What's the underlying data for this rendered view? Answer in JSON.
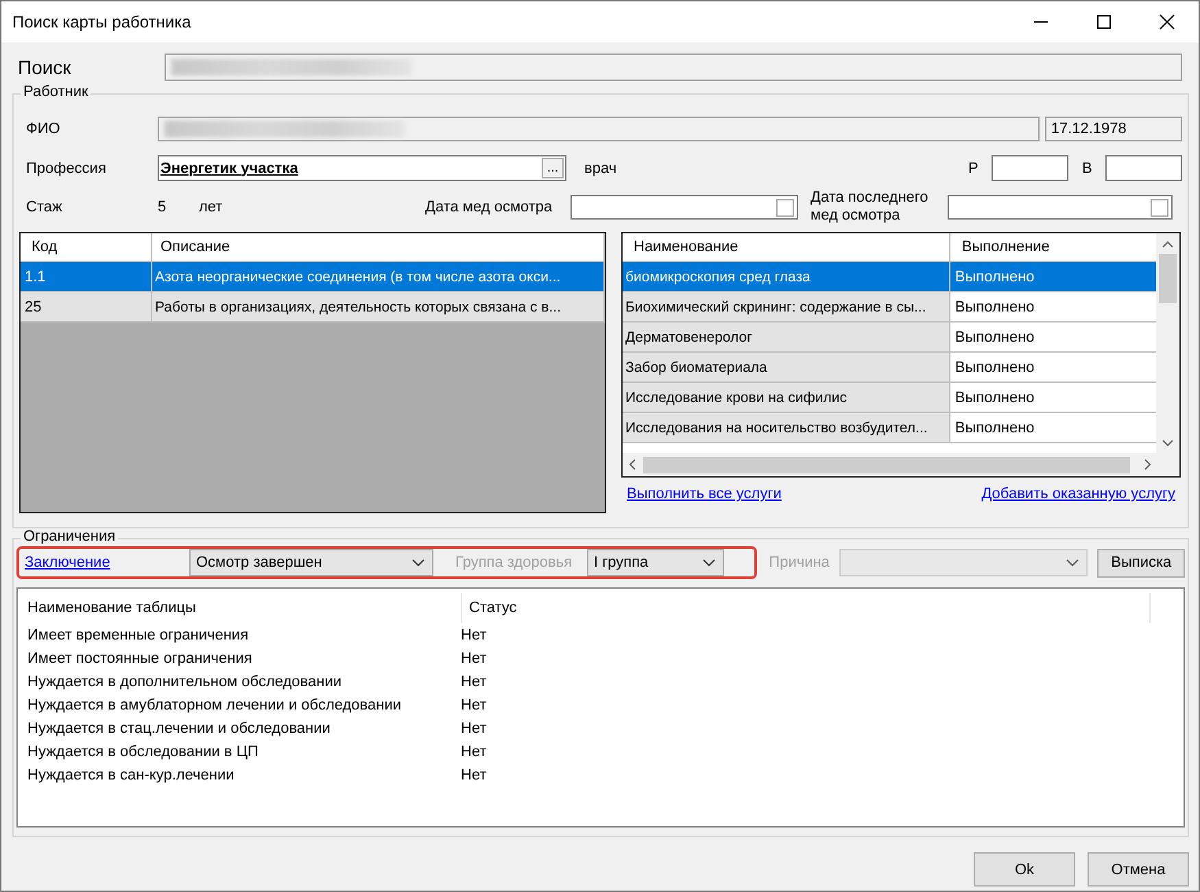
{
  "window": {
    "title": "Поиск карты работника"
  },
  "search": {
    "label": "Поиск",
    "redacted": true
  },
  "worker": {
    "group_label": "Работник",
    "fio": {
      "label": "ФИО",
      "redacted": true,
      "birth_date": "17.12.1978"
    },
    "profession": {
      "label": "Профессия",
      "value": "Энергетик участка",
      "browse": "...",
      "role": "врач",
      "r_label": "Р",
      "v_label": "В"
    },
    "experience": {
      "label": "Стаж",
      "value": "5",
      "unit": "лет"
    },
    "exam_date": {
      "label": "Дата мед осмотра",
      "checked": false
    },
    "last_exam_date": {
      "label": "Дата последнего мед осмотра",
      "checked": false
    }
  },
  "factors": {
    "columns": [
      "Код",
      "Описание"
    ],
    "rows": [
      {
        "code": "1.1",
        "description": "Азота неорганические соединения (в том числе азота окси...",
        "selected": true
      },
      {
        "code": "25",
        "description": "Работы в организациях, деятельность которых связана с в...",
        "selected": false
      }
    ]
  },
  "services": {
    "columns": [
      "Наименование",
      "Выполнение"
    ],
    "rows": [
      {
        "name": "биомикроскопия сред глаза",
        "status": "Выполнено",
        "selected": true
      },
      {
        "name": "Биохимический скрининг: содержание в сы...",
        "status": "Выполнено",
        "selected": false
      },
      {
        "name": "Дерматовенеролог",
        "status": "Выполнено",
        "selected": false
      },
      {
        "name": "Забор биоматериала",
        "status": "Выполнено",
        "selected": false
      },
      {
        "name": "Исследование крови на сифилис",
        "status": "Выполнено",
        "selected": false
      },
      {
        "name": "Исследования на носительство возбудител...",
        "status": "Выполнено",
        "selected": false
      }
    ],
    "links": [
      "Выполнить все услуги",
      "Добавить оказанную услугу"
    ]
  },
  "restrictions": {
    "group_label": "Ограничения",
    "conclusion_link": "Заключение",
    "conclusion_value": "Осмотр завершен",
    "health_group": {
      "label": "Группа здоровья",
      "value": "I группа",
      "disabled": true
    },
    "reason": {
      "label": "Причина",
      "disabled": true
    },
    "extract_button": "Выписка",
    "columns": [
      "Наименование таблицы",
      "Статус"
    ],
    "rows": [
      {
        "name": "Имеет временные ограничения",
        "status": "Нет"
      },
      {
        "name": "Имеет постоянные ограничения",
        "status": "Нет"
      },
      {
        "name": "Нуждается в дополнительном обследовании",
        "status": "Нет"
      },
      {
        "name": "Нуждается в амублаторном лечении и обследовании",
        "status": "Нет"
      },
      {
        "name": "Нуждается в стац.лечении и обследовании",
        "status": "Нет"
      },
      {
        "name": "Нуждается в обследовании в ЦП",
        "status": "Нет"
      },
      {
        "name": "Нуждается в сан-кур.лечении",
        "status": "Нет"
      }
    ]
  },
  "buttons": [
    "Ok",
    "Отмена"
  ]
}
